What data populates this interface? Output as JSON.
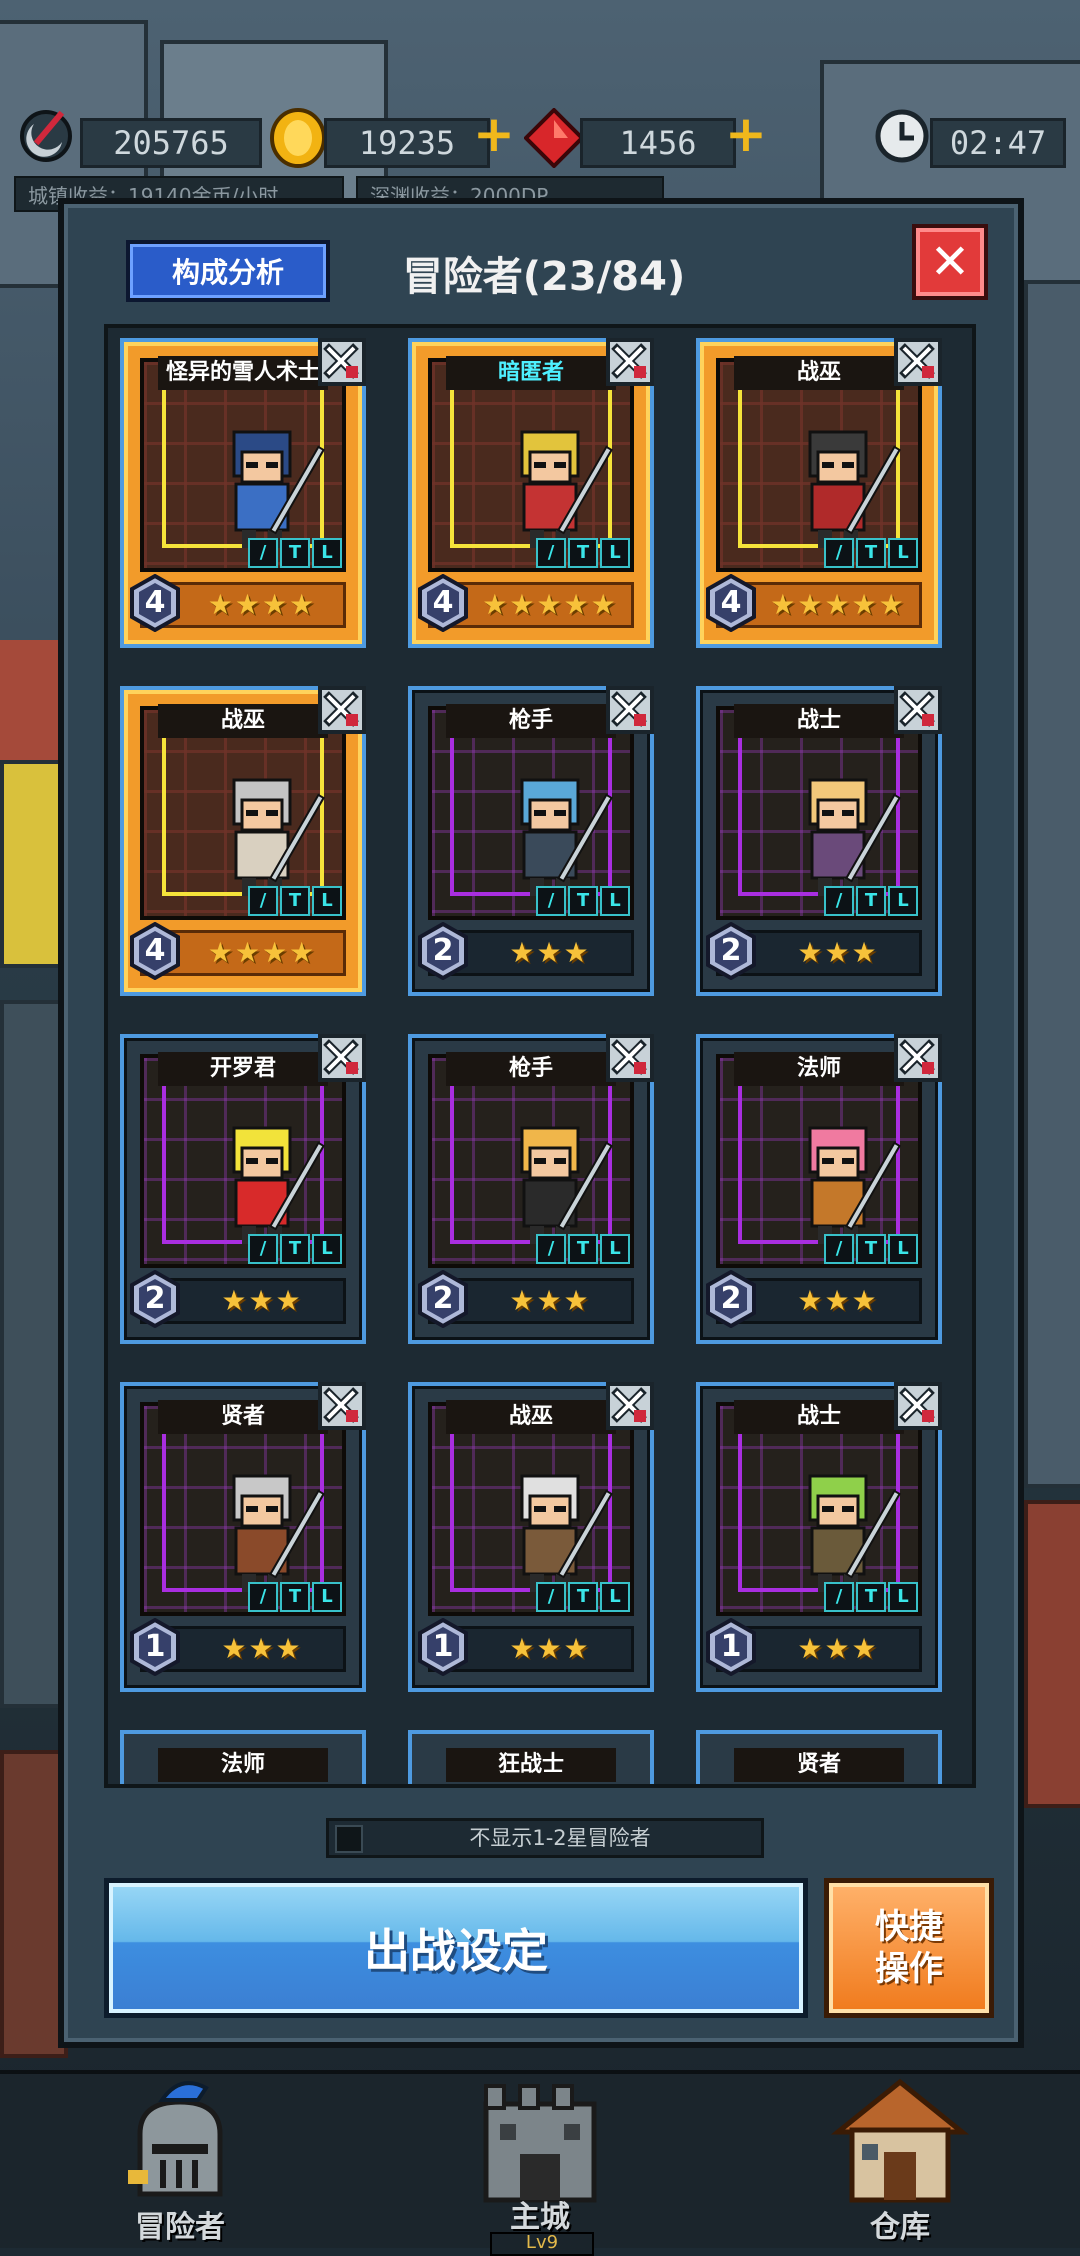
{
  "topbar": {
    "coins_left": "205765",
    "gold": "19235",
    "gems": "1456",
    "clock": "02:47",
    "sub_left": "城镇收益：19140金币/小时",
    "sub_right": "深渊收益：2000DP"
  },
  "modal": {
    "analysis_button": "构成分析",
    "title": "冒险者(23/84)",
    "close_icon": "close-icon",
    "filter_label": "不显示1-2星冒险者",
    "battle_button": "出战设定",
    "quick_button_line1": "快捷",
    "quick_button_line2": "操作"
  },
  "adventurers": [
    {
      "name": "怪异的雪人术士",
      "level": "4",
      "stars": "★★★★",
      "rarity": "gold",
      "name_color": "white",
      "hero_color": "#3b6fc4",
      "hair": "#2b4a86"
    },
    {
      "name": "暗匿者",
      "level": "4",
      "stars": "★★★★★",
      "rarity": "gold",
      "name_color": "cyan",
      "hero_color": "#c43333",
      "hair": "#e2c43c"
    },
    {
      "name": "战巫",
      "level": "4",
      "stars": "★★★★★",
      "rarity": "gold",
      "name_color": "white",
      "hero_color": "#b02a2a",
      "hair": "#3a3a3a"
    },
    {
      "name": "战巫",
      "level": "4",
      "stars": "★★★★",
      "rarity": "gold",
      "name_color": "white",
      "hero_color": "#d9d0c0",
      "hair": "#c4c4c4"
    },
    {
      "name": "枪手",
      "level": "2",
      "stars": "★★★",
      "rarity": "purple",
      "name_color": "white",
      "hero_color": "#3a4a5a",
      "hair": "#5aa8d8"
    },
    {
      "name": "战士",
      "level": "2",
      "stars": "★★★",
      "rarity": "purple",
      "name_color": "white",
      "hero_color": "#6a4a7a",
      "hair": "#f2c87a"
    },
    {
      "name": "开罗君",
      "level": "2",
      "stars": "★★★",
      "rarity": "purple",
      "name_color": "white",
      "hero_color": "#d82a2a",
      "hair": "#f2e33a"
    },
    {
      "name": "枪手",
      "level": "2",
      "stars": "★★★",
      "rarity": "purple",
      "name_color": "white",
      "hero_color": "#2a2a2a",
      "hair": "#f0b64a"
    },
    {
      "name": "法师",
      "level": "2",
      "stars": "★★★",
      "rarity": "purple",
      "name_color": "white",
      "hero_color": "#c4782a",
      "hair": "#f07aa0"
    },
    {
      "name": "贤者",
      "level": "1",
      "stars": "★★★",
      "rarity": "purple",
      "name_color": "white",
      "hero_color": "#8a4a2a",
      "hair": "#c8c8c8"
    },
    {
      "name": "战巫",
      "level": "1",
      "stars": "★★★",
      "rarity": "purple",
      "name_color": "white",
      "hero_color": "#7a5a3a",
      "hair": "#e0e0e0"
    },
    {
      "name": "战士",
      "level": "1",
      "stars": "★★★",
      "rarity": "purple",
      "name_color": "white",
      "hero_color": "#6a5a3a",
      "hair": "#8fd04a"
    }
  ],
  "partial_row": [
    "法师",
    "狂战士",
    "贤者"
  ],
  "nav": {
    "adventurers": "冒险者",
    "main_city": "主城",
    "main_city_level": "Lv9",
    "warehouse": "仓库"
  },
  "colors": {
    "gold_card": "#f29b2a",
    "purple_frame": "#a92ee0",
    "battle_blue": "#3d8ee0",
    "quick_orange": "#f07a1c",
    "close_red": "#e23a3a"
  }
}
